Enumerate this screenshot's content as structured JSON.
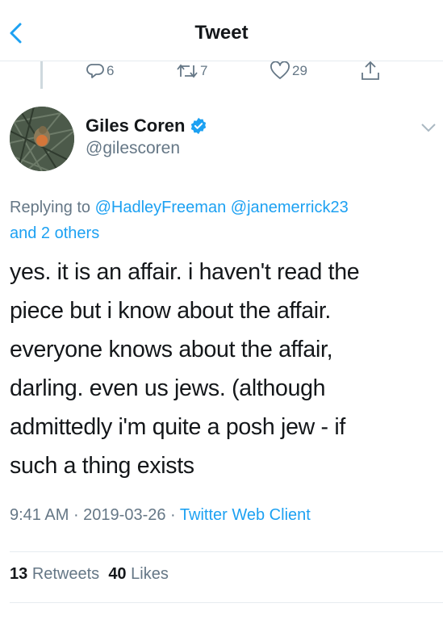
{
  "header": {
    "title": "Tweet"
  },
  "previous_tweet_actions": {
    "reply_count": "6",
    "retweet_count": "7",
    "like_count": "29"
  },
  "author": {
    "name": "Giles Coren",
    "handle": "@gilescoren"
  },
  "reply_info": {
    "prefix": "Replying to ",
    "mention1": "@HadleyFreeman",
    "mention2": "@janemerrick23",
    "others": "and 2 others"
  },
  "tweet": {
    "lines": [
      "yes. it is an affair. i haven't read the",
      "piece but i know about the affair.",
      "everyone knows about the affair,",
      "darling. even us jews. (although",
      "admittedly i'm quite a posh jew - if",
      "such a thing exists"
    ]
  },
  "meta": {
    "time": "9:41 AM",
    "separator": " · ",
    "date": "2019-03-26",
    "client": "Twitter Web Client"
  },
  "stats": {
    "retweets_count": "13",
    "retweets_label": "Retweets",
    "likes_count": "40",
    "likes_label": "Likes"
  },
  "colors": {
    "accent": "#1da1f2",
    "secondary_text": "#657786",
    "primary_text": "#14171a"
  }
}
